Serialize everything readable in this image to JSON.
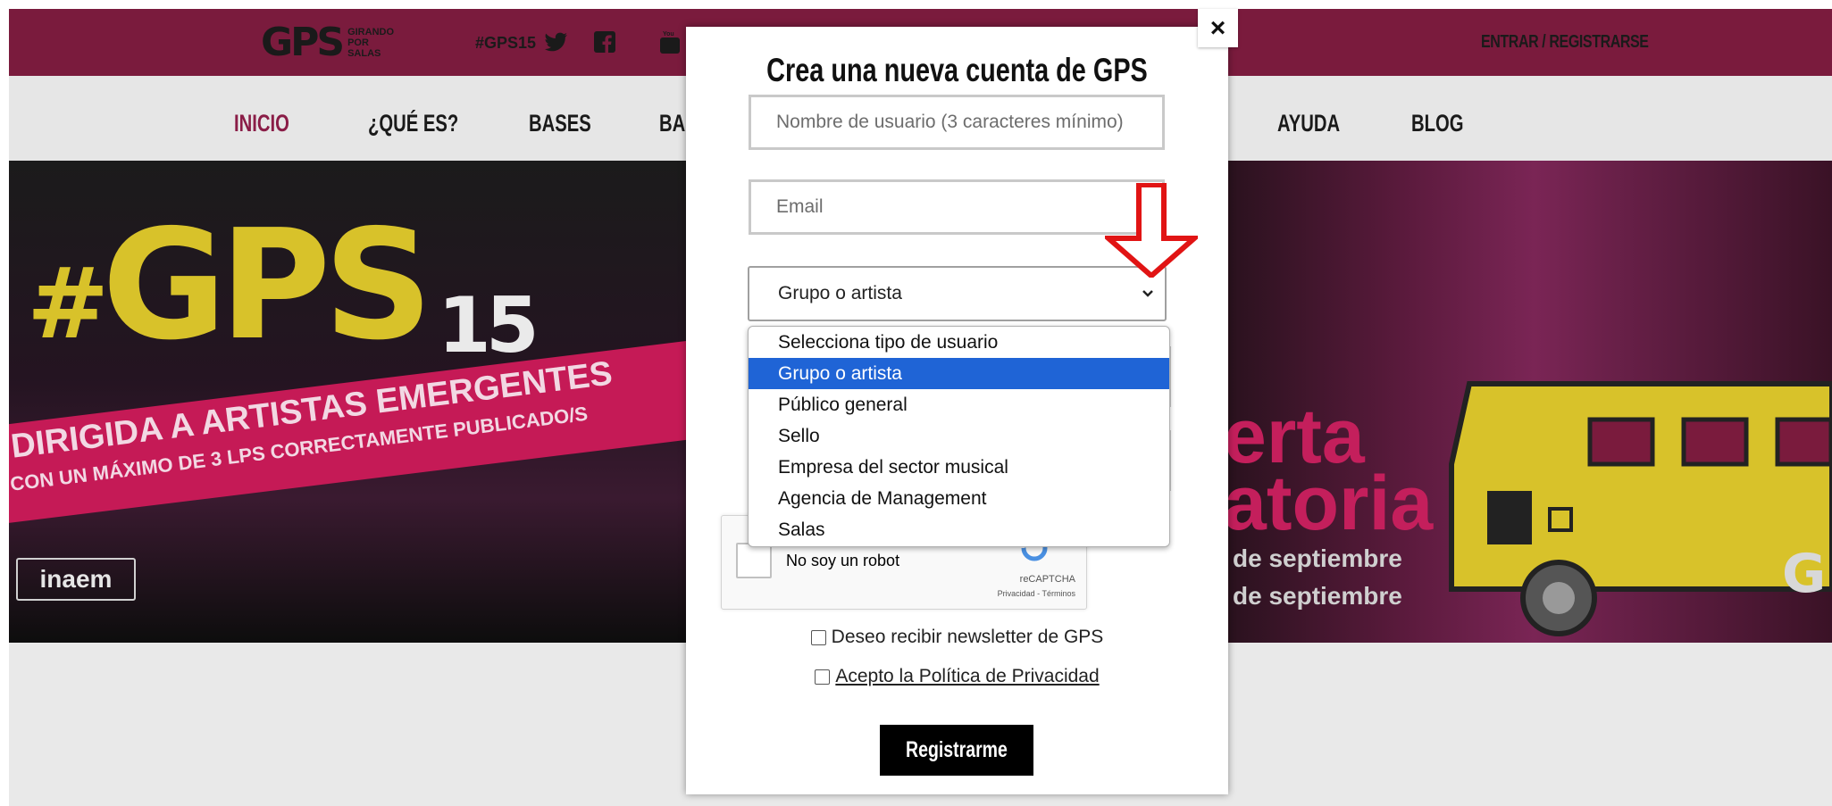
{
  "topbar": {
    "logo_text": "GPS",
    "logo_subtitle": [
      "GIRANDO",
      "POR",
      "SALAS"
    ],
    "hashtag": "#GPS15",
    "social_icons": [
      "twitter-icon",
      "facebook-icon",
      "youtube-icon"
    ],
    "login_label": "ENTRAR / REGISTRARSE"
  },
  "nav": {
    "items": [
      "INICIO",
      "¿QUÉ ES?",
      "BASES",
      "BA",
      "AYUDA",
      "BLOG"
    ]
  },
  "hero": {
    "hash": "#",
    "gps": "GPS",
    "edition": "15",
    "banner_line1": "DIRIGIDA A ARTISTAS EMERGENTES",
    "banner_line2": "CON UN MÁXIMO DE 3 LPS CORRECTAMENTE PUBLICADO/S",
    "big_right_1": "erta",
    "big_right_2": "atoria",
    "date_1": "de septiembre",
    "date_2": "de septiembre",
    "sponsor": "inaem"
  },
  "modal": {
    "close_label": "×",
    "title": "Crea una nueva cuenta de GPS",
    "username_placeholder": "Nombre de usuario (3 caracteres mínimo)",
    "email_placeholder": "Email",
    "user_type_selected": "Grupo o artista",
    "user_type_options": [
      "Selecciona tipo de usuario",
      "Grupo o artista",
      "Público general",
      "Sello",
      "Empresa del sector musical",
      "Agencia de Management",
      "Salas"
    ],
    "captcha": {
      "label": "No soy un robot",
      "brand": "reCAPTCHA",
      "links": "Privacidad - Términos"
    },
    "newsletter_label": "Deseo recibir newsletter de GPS",
    "privacy_label": "Acepto la Política de Privacidad",
    "submit_label": "Registrarme"
  },
  "colors": {
    "topbar": "#7a1b3d",
    "accent_pink": "#c51a56",
    "yellow": "#d8c22a",
    "select_highlight": "#1f64d6",
    "arrow_red": "#e11414"
  }
}
